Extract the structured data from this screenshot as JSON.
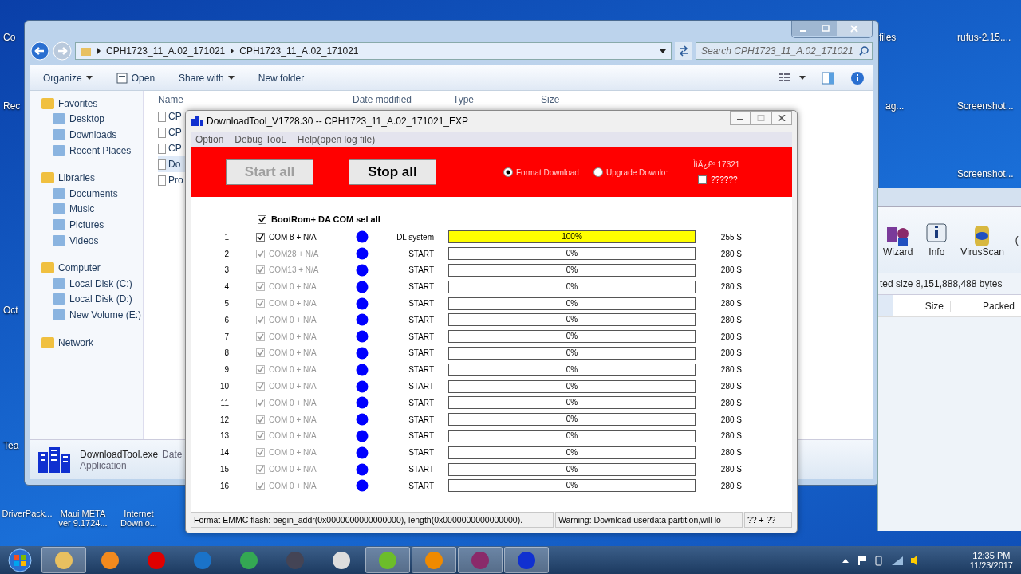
{
  "desktop_icons": [
    {
      "label": "Co",
      "kind": "left"
    },
    {
      "label": "Rec",
      "kind": "left"
    },
    {
      "label": "Oct",
      "kind": "left"
    },
    {
      "label": "Tea",
      "kind": "left"
    },
    {
      "label": "DriverPack...",
      "kind": "bottom"
    },
    {
      "label": "Maui META ver 9.1724...",
      "kind": "bottom"
    },
    {
      "label": "Internet Downlo...",
      "kind": "bottom"
    },
    {
      "label": "files",
      "kind": "right"
    },
    {
      "label": "ag...",
      "kind": "right"
    },
    {
      "label": "rufus-2.15....",
      "kind": "right"
    },
    {
      "label": "Screenshot...",
      "kind": "right"
    },
    {
      "label": "Screenshot...",
      "kind": "right"
    }
  ],
  "explorer": {
    "breadcrumb": [
      "CPH1723_11_A.02_171021",
      "CPH1723_11_A.02_171021"
    ],
    "search": {
      "placeholder": "Search CPH1723_11_A.02_171021"
    },
    "toolbar": [
      {
        "label": "Organize",
        "kind": "menu"
      },
      {
        "label": "Open",
        "kind": "icon"
      },
      {
        "label": "Share with",
        "kind": "menu"
      },
      {
        "label": "New folder",
        "kind": "plain"
      }
    ],
    "columns": [
      "Name",
      "Date modified",
      "Type",
      "Size"
    ],
    "nav": [
      {
        "label": "Favorites",
        "children": [
          {
            "label": "Desktop"
          },
          {
            "label": "Downloads"
          },
          {
            "label": "Recent Places"
          }
        ]
      },
      {
        "label": "Libraries",
        "children": [
          {
            "label": "Documents"
          },
          {
            "label": "Music"
          },
          {
            "label": "Pictures"
          },
          {
            "label": "Videos"
          }
        ]
      },
      {
        "label": "Computer",
        "children": [
          {
            "label": "Local Disk (C:)"
          },
          {
            "label": "Local Disk (D:)"
          },
          {
            "label": "New Volume (E:)"
          }
        ]
      },
      {
        "label": "Network"
      }
    ],
    "files": [
      {
        "name": "CP",
        "selected": false
      },
      {
        "name": "CP",
        "selected": false
      },
      {
        "name": "CP",
        "selected": false
      },
      {
        "name": "Do",
        "selected": true
      },
      {
        "name": "Pro",
        "selected": false
      }
    ],
    "details": {
      "name": "DownloadTool.exe",
      "date_label": "Date",
      "type": "Application"
    }
  },
  "archiver": {
    "toolbar": [
      "Wizard",
      "Info",
      "VirusScan",
      "("
    ],
    "status": "ted size 8,151,888,488 bytes",
    "columns": [
      "Size",
      "Packed"
    ]
  },
  "download_tool": {
    "title": "DownloadTool_V1728.30 -- CPH1723_11_A.02_171021_EXP",
    "menu": [
      "Option",
      "Debug TooL",
      "Help(open log file)"
    ],
    "start_button": {
      "label": "Start all",
      "disabled": true
    },
    "stop_button": {
      "label": "Stop all",
      "disabled": false
    },
    "modes": [
      {
        "label": "Format Download",
        "selected": true
      },
      {
        "label": "Upgrade Downlo:",
        "selected": false
      }
    ],
    "counter": "ÌìÄ¿£º 17321",
    "option": {
      "label": "??????",
      "checked": false
    },
    "select_all": {
      "label": "BootRom+ DA COM sel all",
      "checked": true
    },
    "ports": [
      {
        "index": "1",
        "port": "COM 8 + N/A",
        "checked": true,
        "disabled": false,
        "status": "DL system",
        "level": 1,
        "percent": "100%",
        "time": "255 S"
      },
      {
        "index": "2",
        "port": "COM28 + N/A",
        "checked": true,
        "disabled": true,
        "status": "START",
        "level": 0,
        "percent": "0%",
        "time": "280 S"
      },
      {
        "index": "3",
        "port": "COM13 + N/A",
        "checked": true,
        "disabled": true,
        "status": "START",
        "level": 0,
        "percent": "0%",
        "time": "280 S"
      },
      {
        "index": "4",
        "port": "COM 0 + N/A",
        "checked": true,
        "disabled": true,
        "status": "START",
        "level": 0,
        "percent": "0%",
        "time": "280 S"
      },
      {
        "index": "5",
        "port": "COM 0 + N/A",
        "checked": true,
        "disabled": true,
        "status": "START",
        "level": 0,
        "percent": "0%",
        "time": "280 S"
      },
      {
        "index": "6",
        "port": "COM 0 + N/A",
        "checked": true,
        "disabled": true,
        "status": "START",
        "level": 0,
        "percent": "0%",
        "time": "280 S"
      },
      {
        "index": "7",
        "port": "COM 0 + N/A",
        "checked": true,
        "disabled": true,
        "status": "START",
        "level": 0,
        "percent": "0%",
        "time": "280 S"
      },
      {
        "index": "8",
        "port": "COM 0 + N/A",
        "checked": true,
        "disabled": true,
        "status": "START",
        "level": 0,
        "percent": "0%",
        "time": "280 S"
      },
      {
        "index": "9",
        "port": "COM 0 + N/A",
        "checked": true,
        "disabled": true,
        "status": "START",
        "level": 0,
        "percent": "0%",
        "time": "280 S"
      },
      {
        "index": "10",
        "port": "COM 0 + N/A",
        "checked": true,
        "disabled": true,
        "status": "START",
        "level": 0,
        "percent": "0%",
        "time": "280 S"
      },
      {
        "index": "11",
        "port": "COM 0 + N/A",
        "checked": true,
        "disabled": true,
        "status": "START",
        "level": 0,
        "percent": "0%",
        "time": "280 S"
      },
      {
        "index": "12",
        "port": "COM 0 + N/A",
        "checked": true,
        "disabled": true,
        "status": "START",
        "level": 0,
        "percent": "0%",
        "time": "280 S"
      },
      {
        "index": "13",
        "port": "COM 0 + N/A",
        "checked": true,
        "disabled": true,
        "status": "START",
        "level": 0,
        "percent": "0%",
        "time": "280 S"
      },
      {
        "index": "14",
        "port": "COM 0 + N/A",
        "checked": true,
        "disabled": true,
        "status": "START",
        "level": 0,
        "percent": "0%",
        "time": "280 S"
      },
      {
        "index": "15",
        "port": "COM 0 + N/A",
        "checked": true,
        "disabled": true,
        "status": "START",
        "level": 0,
        "percent": "0%",
        "time": "280 S"
      },
      {
        "index": "16",
        "port": "COM 0 + N/A",
        "checked": true,
        "disabled": true,
        "status": "START",
        "level": 0,
        "percent": "0%",
        "time": "280 S"
      }
    ],
    "status_bar": [
      "Format EMMC flash:  begin_addr(0x0000000000000000), length(0x0000000000000000).",
      "Warning: Download userdata partition,will lo",
      "?? + ??"
    ]
  },
  "taskbar": {
    "time": "12:35 PM",
    "date": "11/23/2017"
  }
}
